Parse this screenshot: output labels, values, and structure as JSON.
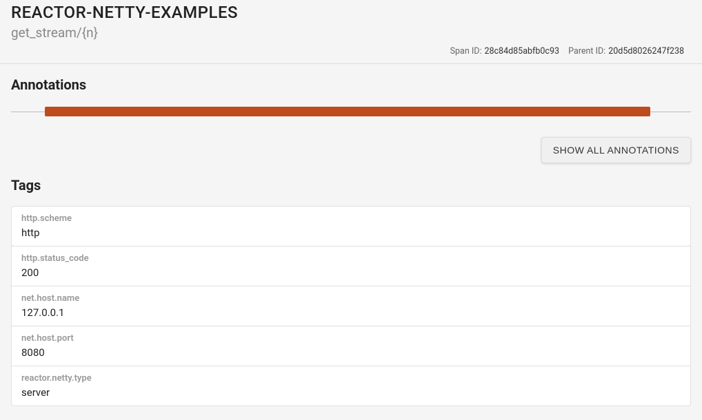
{
  "header": {
    "service_name": "REACTOR-NETTY-EXAMPLES",
    "span_name": "get_stream/{n}",
    "span_id_label": "Span ID:",
    "span_id_value": "28c84d85abfb0c93",
    "parent_id_label": "Parent ID:",
    "parent_id_value": "20d5d8026247f238"
  },
  "annotations": {
    "title": "Annotations",
    "show_all_label": "SHOW ALL ANNOTATIONS"
  },
  "tags_section": {
    "title": "Tags",
    "items": [
      {
        "key": "http.scheme",
        "value": "http"
      },
      {
        "key": "http.status_code",
        "value": "200"
      },
      {
        "key": "net.host.name",
        "value": "127.0.0.1"
      },
      {
        "key": "net.host.port",
        "value": "8080"
      },
      {
        "key": "reactor.netty.type",
        "value": "server"
      }
    ]
  }
}
